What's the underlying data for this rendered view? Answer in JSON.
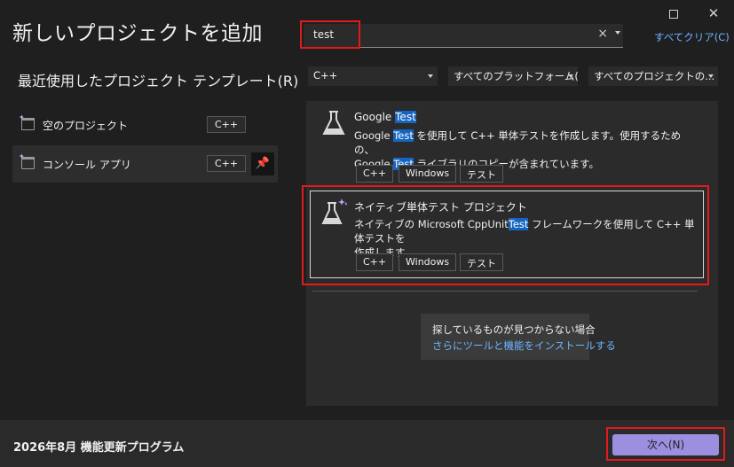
{
  "window": {
    "title": "新しいプロジェクトを追加",
    "recent_heading": "最近使用したプロジェクト テンプレート(R)"
  },
  "search": {
    "value": "test",
    "clear_glyph": "×",
    "clear_all": "すべてクリア(C)"
  },
  "filters": {
    "language": "C++",
    "platform": "すべてのプラットフォーム(P)",
    "project_type": "すべてのプロジェクトの..."
  },
  "recent": [
    {
      "label": "空のプロジェクト",
      "tag": "C++",
      "icon": "empty-project-icon"
    },
    {
      "label": "コンソール アプリ",
      "tag": "C++",
      "icon": "console-app-icon",
      "pin": "📌"
    }
  ],
  "results": [
    {
      "title_parts": [
        "Google ",
        "Test"
      ],
      "desc_line1": [
        "Google ",
        "Test",
        " を使用して C++ 単体テストを作成します。使用するための、"
      ],
      "desc_line2": [
        "Google ",
        "Test",
        " ライブラリのコピーが含まれています。"
      ],
      "tags": [
        "C++",
        "Windows",
        "テスト"
      ],
      "icon": "flask-icon"
    },
    {
      "title": "ネイティブ単体テスト プロジェクト",
      "desc_line1": [
        "ネイティブの Microsoft CppUnit",
        "Test",
        " フレームワークを使用して C++ 単体テストを"
      ],
      "desc_line2_text": "作成します。",
      "tags": [
        "C++",
        "Windows",
        "テスト"
      ],
      "icon": "flask-sparkle-icon"
    }
  ],
  "not_found": {
    "line1": "探しているものが見つからない場合",
    "link": "さらにツールと機能をインストールする"
  },
  "footer": {
    "update": "2026年8月 機能更新プログラム",
    "next": "次へ(N)"
  },
  "colors": {
    "accent": "#9d8fe0",
    "highlight": "#1565c0",
    "link": "#6fb4ff",
    "annotation": "#e01b1b"
  }
}
